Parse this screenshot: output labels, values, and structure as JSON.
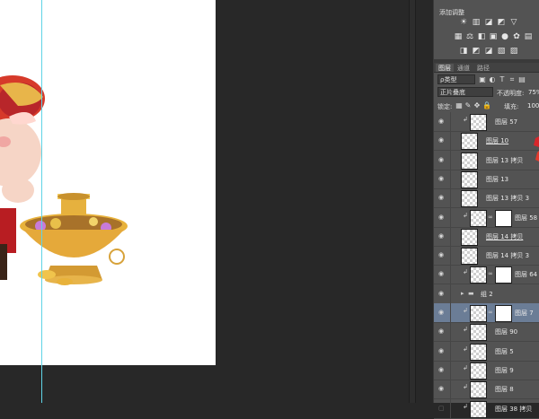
{
  "adjustments": {
    "title": "添加调整",
    "row1": [
      "brightness-icon",
      "levels-icon",
      "curves-icon",
      "exposure-icon"
    ],
    "row2": [
      "vibrance-icon",
      "hue-saturation-icon",
      "color-balance-icon",
      "black-white-icon",
      "photo-filter-icon",
      "channel-mixer-icon"
    ],
    "row3": [
      "invert-icon",
      "posterize-icon",
      "threshold-icon",
      "gradient-map-icon",
      "selective-color-icon"
    ]
  },
  "layers_panel": {
    "tabs": [
      "图层",
      "通道",
      "路径"
    ],
    "filter_label": "ρ类型",
    "blend_mode": "正片叠底",
    "opacity_label": "不透明度:",
    "opacity_value": "75%",
    "lock_label": "锁定:",
    "fill_label": "填充:",
    "fill_value": "100%"
  },
  "layers": [
    {
      "name": "图层 57",
      "visible": true,
      "clipped": true,
      "mask": false,
      "selected": false,
      "underline": false
    },
    {
      "name": "图层 10",
      "visible": true,
      "clipped": false,
      "mask": false,
      "selected": false,
      "underline": true
    },
    {
      "name": "图层 13 拷贝",
      "visible": true,
      "clipped": false,
      "mask": false,
      "selected": false,
      "underline": false
    },
    {
      "name": "图层 13",
      "visible": true,
      "clipped": false,
      "mask": false,
      "selected": false,
      "underline": false
    },
    {
      "name": "图层 13 拷贝 3",
      "visible": true,
      "clipped": false,
      "mask": false,
      "selected": false,
      "underline": false
    },
    {
      "name": "图层 58",
      "visible": true,
      "clipped": true,
      "mask": true,
      "selected": false,
      "underline": false
    },
    {
      "name": "图层 14 拷贝",
      "visible": true,
      "clipped": false,
      "mask": false,
      "selected": false,
      "underline": true
    },
    {
      "name": "图层 14 拷贝 3",
      "visible": true,
      "clipped": false,
      "mask": false,
      "selected": false,
      "underline": false
    },
    {
      "name": "图层 64",
      "visible": true,
      "clipped": true,
      "mask": true,
      "selected": false,
      "underline": false
    },
    {
      "name": "组 2",
      "visible": true,
      "clipped": false,
      "mask": false,
      "selected": false,
      "underline": false,
      "group": true
    },
    {
      "name": "图层 7",
      "visible": true,
      "clipped": true,
      "mask": true,
      "selected": true,
      "underline": false
    },
    {
      "name": "图层 90",
      "visible": true,
      "clipped": true,
      "mask": false,
      "selected": false,
      "underline": false
    },
    {
      "name": "图层 5",
      "visible": true,
      "clipped": true,
      "mask": false,
      "selected": false,
      "underline": false
    },
    {
      "name": "图层 9",
      "visible": true,
      "clipped": true,
      "mask": false,
      "selected": false,
      "underline": false
    },
    {
      "name": "图层 8",
      "visible": true,
      "clipped": true,
      "mask": false,
      "selected": false,
      "underline": false
    },
    {
      "name": "图层 38 拷贝",
      "visible": false,
      "clipped": true,
      "mask": false,
      "selected": false,
      "underline": false
    }
  ],
  "colors": {
    "selection": "#6b7d96",
    "guide": "#5fd3e6",
    "panel": "#535353"
  }
}
